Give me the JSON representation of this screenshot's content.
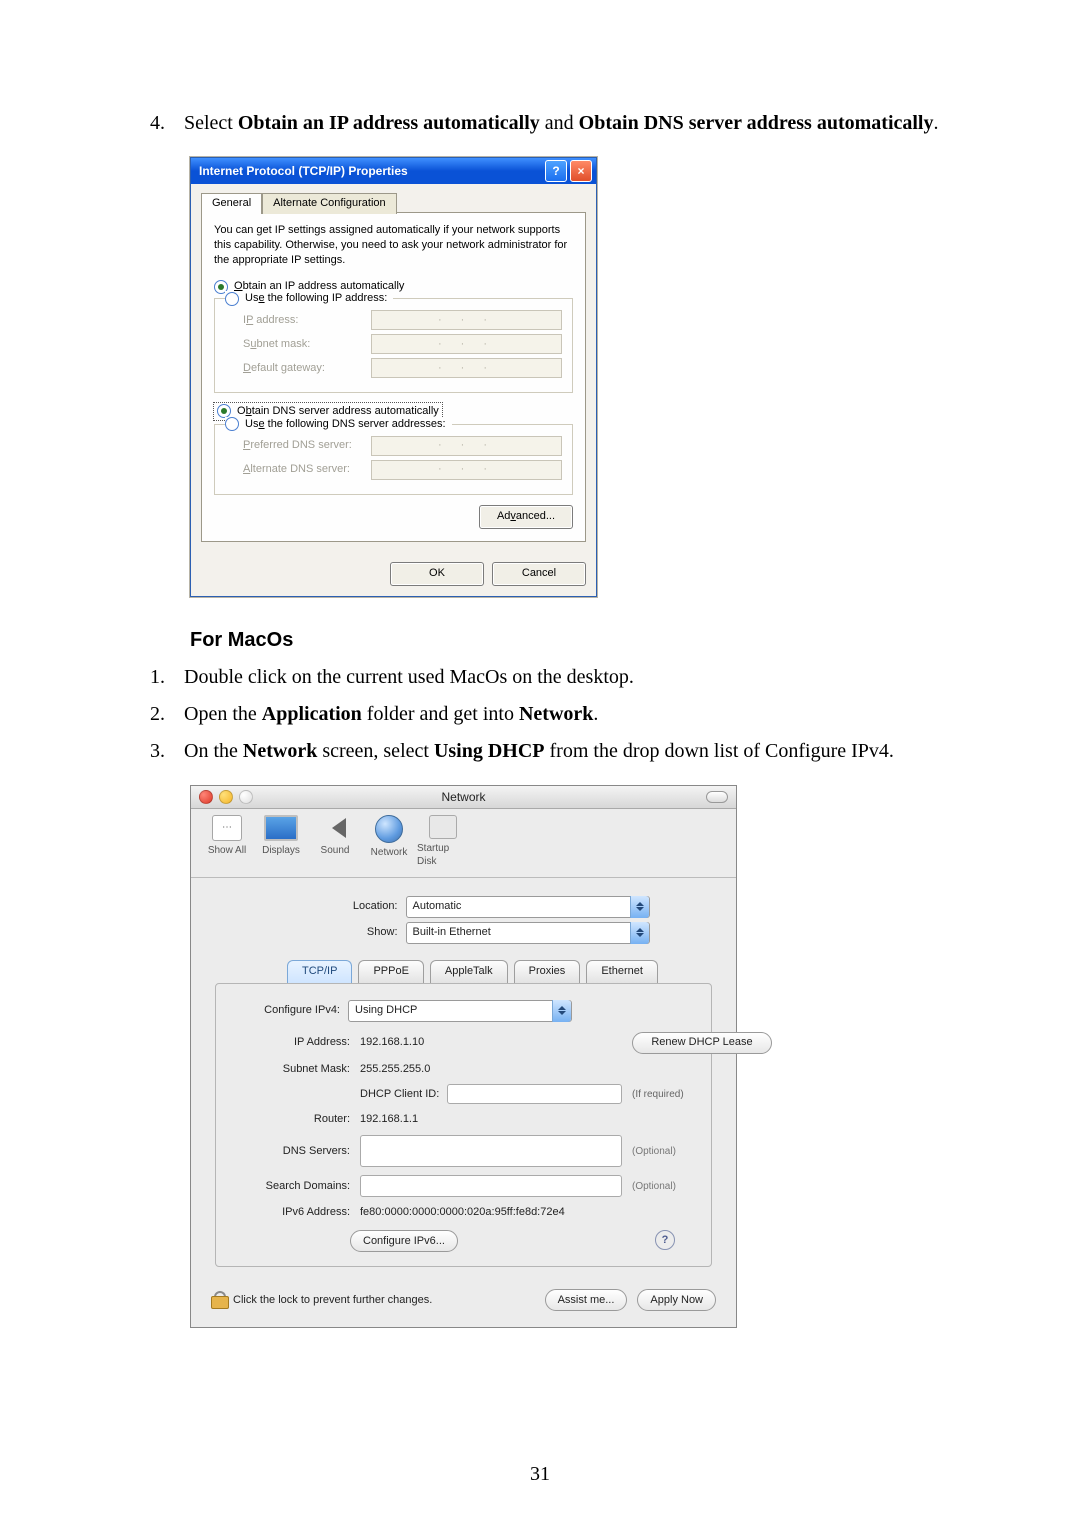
{
  "step4": {
    "num": "4.",
    "prefix": "Select ",
    "bold1": "Obtain an IP address automatically",
    "middle": " and ",
    "bold2": "Obtain DNS server address automatically",
    "suffix": "."
  },
  "xp": {
    "title": "Internet Protocol (TCP/IP) Properties",
    "help": "?",
    "close": "×",
    "tabs": {
      "general": "General",
      "alt": "Alternate Configuration"
    },
    "info": "You can get IP settings assigned automatically if your network supports this capability. Otherwise, you need to ask your network administrator for the appropriate IP settings.",
    "ip_auto_pre": "O",
    "ip_auto_rest": "btain an IP address automatically",
    "ip_manual_pre": "Us",
    "ip_manual_under": "e",
    "ip_manual_rest": " the following IP address:",
    "labels": {
      "ip_pre": "I",
      "ip_under": "P",
      "ip_rest": " address:",
      "subnet_pre": "S",
      "subnet_under": "u",
      "subnet_rest": "bnet mask:",
      "gw_pre": "",
      "gw_under": "D",
      "gw_rest": "efault gateway:"
    },
    "dns_auto_pre": "O",
    "dns_auto_under": "b",
    "dns_auto_rest": "tain DNS server address automatically",
    "dns_manual_pre": "Us",
    "dns_manual_under": "e",
    "dns_manual_rest": " the following DNS server addresses:",
    "dnslabels": {
      "pref_pre": "",
      "pref_under": "P",
      "pref_rest": "referred DNS server:",
      "alt_pre": "",
      "alt_under": "A",
      "alt_rest": "lternate DNS server:"
    },
    "adv_pre": "Ad",
    "adv_under": "v",
    "adv_rest": "anced...",
    "ok": "OK",
    "cancel": "Cancel"
  },
  "macSection": {
    "heading": "For MacOs"
  },
  "macSteps": {
    "s1": "Double click on the current used MacOs on the desktop.",
    "s2_pre": "Open the ",
    "s2_b": "Application",
    "s2_mid": " folder and get into ",
    "s2_b2": "Network",
    "s2_suf": ".",
    "s3_pre": "On the ",
    "s3_b1": "Network",
    "s3_mid": " screen, select ",
    "s3_b2": "Using DHCP",
    "s3_suf": " from the drop down list of Configure IPv4."
  },
  "mac": {
    "title": "Network",
    "toolbar": {
      "showall": "Show All",
      "displays": "Displays",
      "sound": "Sound",
      "network": "Network",
      "startup": "Startup Disk"
    },
    "location_label": "Location:",
    "location_value": "Automatic",
    "show_label": "Show:",
    "show_value": "Built-in Ethernet",
    "tabs": {
      "tcpip": "TCP/IP",
      "pppoe": "PPPoE",
      "appletalk": "AppleTalk",
      "proxies": "Proxies",
      "ethernet": "Ethernet"
    },
    "cfg_label": "Configure IPv4:",
    "cfg_value": "Using DHCP",
    "ip_label": "IP Address:",
    "ip_value": "192.168.1.10",
    "renew": "Renew DHCP Lease",
    "subnet_label": "Subnet Mask:",
    "subnet_value": "255.255.255.0",
    "dhcp_client": "DHCP Client ID:",
    "if_required": "(If required)",
    "router_label": "Router:",
    "router_value": "192.168.1.1",
    "dns_label": "DNS Servers:",
    "search_label": "Search Domains:",
    "optional": "(Optional)",
    "ipv6_label": "IPv6 Address:",
    "ipv6_value": "fe80:0000:0000:0000:020a:95ff:fe8d:72e4",
    "cfg6": "Configure IPv6...",
    "help": "?",
    "lock_msg": "Click the lock to prevent further changes.",
    "assist": "Assist me...",
    "apply": "Apply Now"
  },
  "pageNumber": "31"
}
